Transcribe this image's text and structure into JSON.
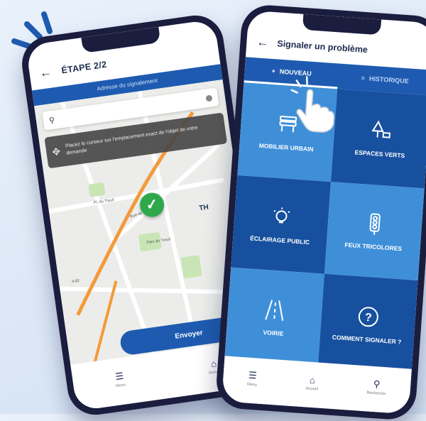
{
  "left_phone": {
    "title": "ÉTAPE 2/2",
    "band_text": "Adresse du signalement",
    "search_placeholder": "",
    "tooltip_text": "Placez le curseur sur l'emplacement exact de l'objet de votre demande",
    "map_labels": [
      "Pl. du Treuil",
      "Rue de Bichat",
      "Parc du Treuil",
      "TH",
      "A 82"
    ],
    "send_button": "Envoyer",
    "nav": [
      {
        "icon": "menu-icon",
        "label": "Menu"
      },
      {
        "icon": "home-icon",
        "label": "Accueil"
      }
    ]
  },
  "right_phone": {
    "title": "Signaler un problème",
    "tabs": [
      {
        "label": "NOUVEAU",
        "icon": "plus-icon",
        "active": true
      },
      {
        "label": "HISTORIQUE",
        "icon": "list-icon",
        "active": false
      }
    ],
    "tiles": [
      {
        "label": "MOBILIER URBAIN",
        "icon": "bench-icon"
      },
      {
        "label": "ESPACES VERTS",
        "icon": "tree-icon"
      },
      {
        "label": "ÉCLAIRAGE PUBLIC",
        "icon": "bulb-icon"
      },
      {
        "label": "FEUX TRICOLORES",
        "icon": "traffic-light-icon"
      },
      {
        "label": "VOIRIE",
        "icon": "road-icon"
      },
      {
        "label": "COMMENT SIGNALER ?",
        "icon": "question-icon"
      }
    ],
    "nav": [
      {
        "icon": "menu-icon",
        "label": "Menu"
      },
      {
        "icon": "home-icon",
        "label": "Accueil"
      },
      {
        "icon": "search-icon",
        "label": "Recherche"
      }
    ]
  },
  "colors": {
    "primary": "#1e5bb0",
    "light_tile": "#3f8fd8",
    "dark_tile": "#17509e",
    "success": "#2ea84a"
  }
}
